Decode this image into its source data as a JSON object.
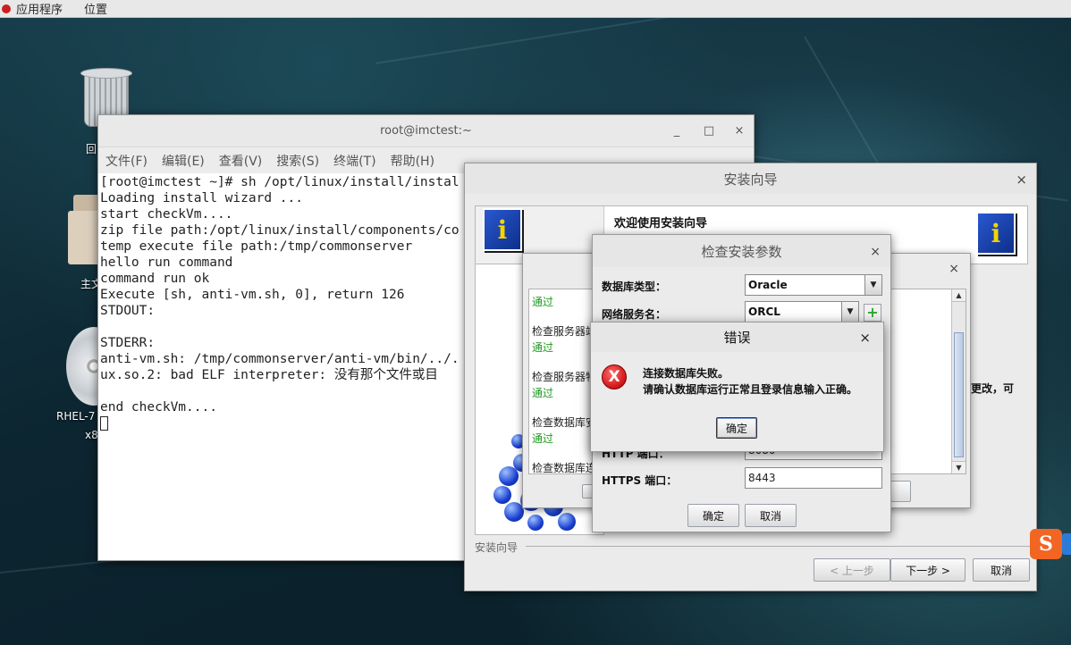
{
  "topbar": {
    "apps": "应用程序",
    "places": "位置"
  },
  "desktop": {
    "trash_label": "回",
    "folder_label": "主文",
    "disc_label_1": "RHEL-7",
    "disc_label_2": "x8"
  },
  "terminal": {
    "title": "root@imctest:~",
    "minimize": "_",
    "maximize": "□",
    "close": "×",
    "menu": [
      "文件(F)",
      "编辑(E)",
      "查看(V)",
      "搜索(S)",
      "终端(T)",
      "帮助(H)"
    ],
    "lines": [
      "[root@imctest ~]# sh /opt/linux/install/instal",
      "Loading install wizard ...",
      "start checkVm....",
      "zip file path:/opt/linux/install/components/co",
      "temp execute file path:/tmp/commonserver",
      "hello run command",
      "command run ok",
      "Execute [sh, anti-vm.sh, 0], return 126",
      "STDOUT:",
      "",
      "STDERR:",
      "anti-vm.sh: /tmp/commonserver/anti-vm/bin/../.",
      "ux.so.2: bad ELF interpreter: 没有那个文件或目",
      "",
      "end checkVm...."
    ]
  },
  "wizard": {
    "title": "安装向导",
    "close": "×",
    "header_title": "欢迎使用安装向导",
    "footer_label": "安装向导",
    "prev": "< 上一步",
    "next": "下一步 >",
    "cancel": "取消",
    "icon_glyph": "i"
  },
  "checklist": {
    "close": "×",
    "items": [
      {
        "text": "通过",
        "status": "ok"
      },
      {
        "text": "检查服务器端",
        "status": "label"
      },
      {
        "text": "通过",
        "status": "ok"
      },
      {
        "text": "检查服务器物",
        "status": "label"
      },
      {
        "text": "通过",
        "status": "ok"
      },
      {
        "text": "检查数据库安",
        "status": "label"
      },
      {
        "text": "通过",
        "status": "ok"
      },
      {
        "text": "检查数据库连",
        "status": "label"
      }
    ],
    "right_text": "更改，可"
  },
  "params": {
    "title": "检查安装参数",
    "close": "×",
    "db_type_label": "数据库类型：",
    "db_type_value": "Oracle",
    "service_label": "网络服务名：",
    "service_value": "ORCL",
    "http_label": "HTTP 端口：",
    "http_value": "8080",
    "https_label": "HTTPS 端口：",
    "https_value": "8443",
    "ok": "确定",
    "cancel": "取消"
  },
  "error": {
    "title": "错误",
    "close": "×",
    "icon_glyph": "X",
    "line1": "连接数据库失败。",
    "line2": "请确认数据库运行正常且登录信息输入正确。",
    "ok": "确定"
  },
  "ime": {
    "glyph": "S"
  }
}
